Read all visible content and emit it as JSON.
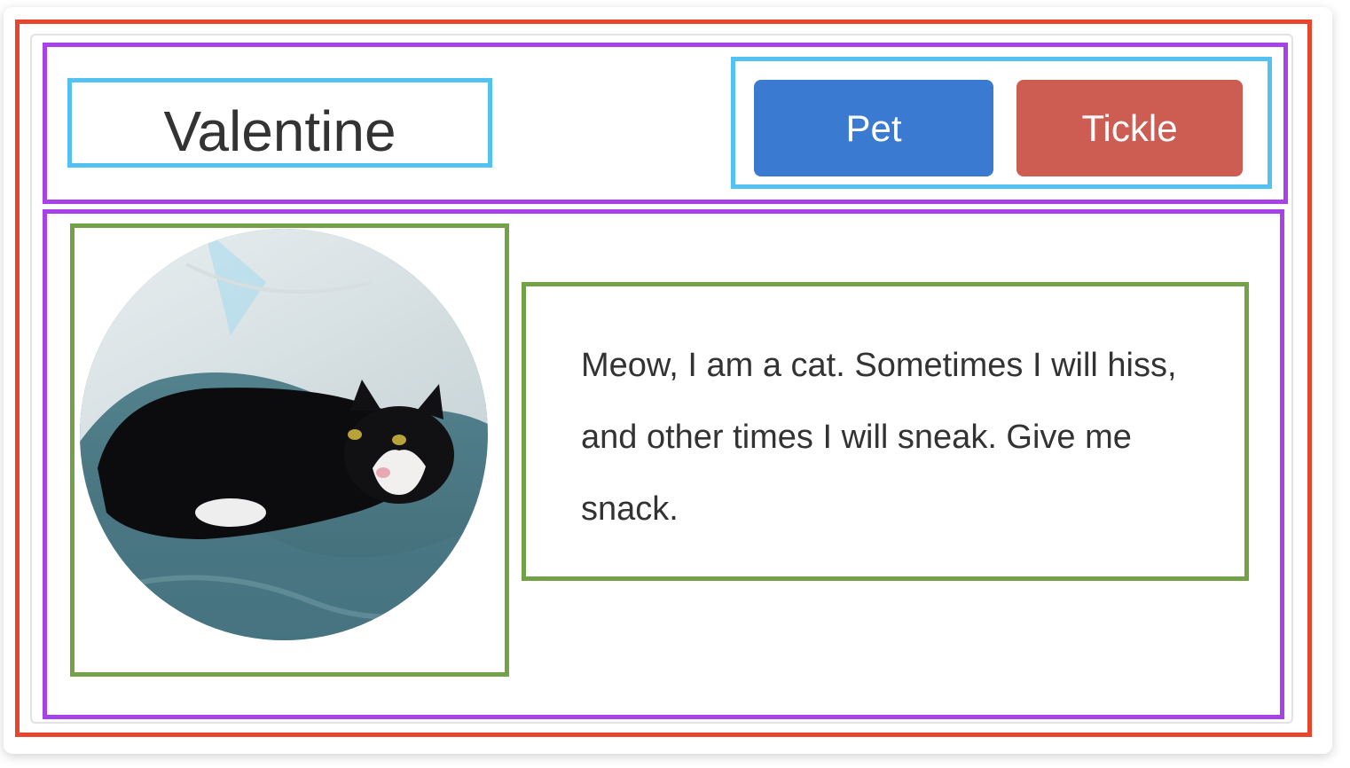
{
  "profile": {
    "name": "Valentine",
    "bio": "Meow, I am a cat. Sometimes I will hiss, and other times I will sneak. Give me snack."
  },
  "actions": {
    "pet_label": "Pet",
    "tickle_label": "Tickle"
  },
  "colors": {
    "outer_border": "#e8452e",
    "row_border": "#a742e8",
    "component_border": "#52c2f2",
    "content_border": "#72a147",
    "pet_button": "#3b7ad1",
    "tickle_button": "#cd5c52",
    "text": "#333333"
  },
  "icons": {
    "avatar": "cat-photo"
  }
}
